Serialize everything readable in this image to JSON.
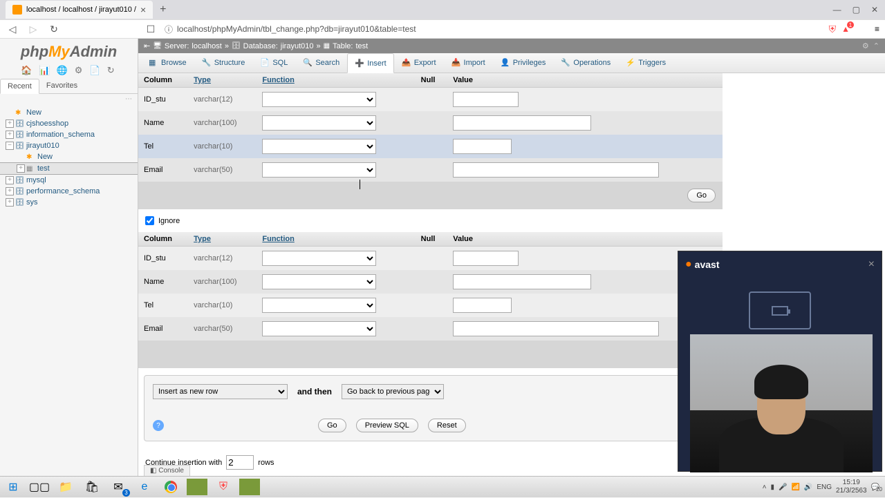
{
  "browser": {
    "tab_title": "localhost / localhost / jirayut010 /",
    "url": "localhost/phpMyAdmin/tbl_change.php?db=jirayut010&table=test"
  },
  "logo": {
    "php": "php",
    "my": "My",
    "admin": "Admin"
  },
  "side_tabs": {
    "recent": "Recent",
    "favorites": "Favorites"
  },
  "tree": {
    "new": "New",
    "cjshoesshop": "cjshoesshop",
    "information_schema": "information_schema",
    "jirayut010": "jirayut010",
    "jirayut_new": "New",
    "test": "test",
    "mysql": "mysql",
    "performance_schema": "performance_schema",
    "sys": "sys"
  },
  "breadcrumb": {
    "server_lbl": "Server:",
    "server": "localhost",
    "db_lbl": "Database:",
    "db": "jirayut010",
    "tbl_lbl": "Table:",
    "tbl": "test"
  },
  "tabs": {
    "browse": "Browse",
    "structure": "Structure",
    "sql": "SQL",
    "search": "Search",
    "insert": "Insert",
    "export": "Export",
    "import": "Import",
    "privileges": "Privileges",
    "operations": "Operations",
    "triggers": "Triggers"
  },
  "headers": {
    "column": "Column",
    "type": "Type",
    "function": "Function",
    "null": "Null",
    "value": "Value"
  },
  "rows": [
    {
      "col": "ID_stu",
      "type": "varchar(12)",
      "vclass": "val-12"
    },
    {
      "col": "Name",
      "type": "varchar(100)",
      "vclass": "val-100"
    },
    {
      "col": "Tel",
      "type": "varchar(10)",
      "vclass": "val-10"
    },
    {
      "col": "Email",
      "type": "varchar(50)",
      "vclass": "val-50"
    }
  ],
  "buttons": {
    "go": "Go",
    "preview": "Preview SQL",
    "reset": "Reset"
  },
  "ignore": "Ignore",
  "insert_opts": {
    "mode": "Insert as new row",
    "and_then": "and then",
    "after": "Go back to previous page"
  },
  "continue": {
    "pre": "Continue insertion with",
    "val": "2",
    "post": "rows"
  },
  "console": "Console",
  "avast": "avast",
  "taskbar": {
    "lang": "ENG",
    "time": "15:19",
    "date": "21/3/2563",
    "notif": "20",
    "mail": "3"
  }
}
